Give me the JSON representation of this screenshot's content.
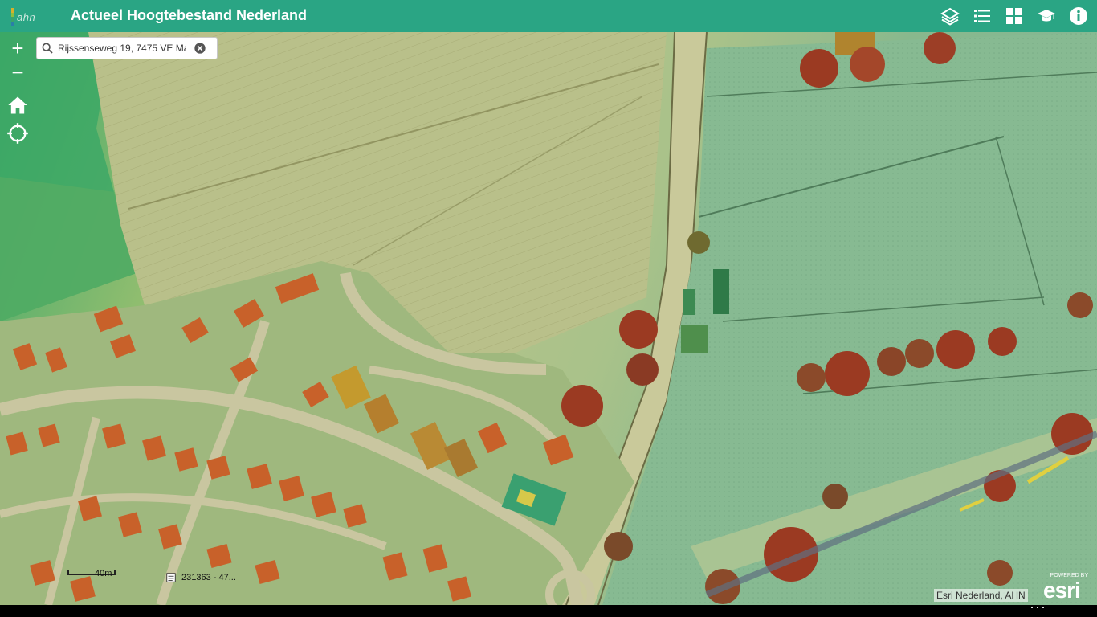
{
  "header": {
    "logo_text": "ahn",
    "title": "Actueel Hoogtebestand Nederland",
    "icons": [
      "layers-icon",
      "legend-icon",
      "basemap-gallery-icon",
      "education-icon",
      "info-icon"
    ]
  },
  "search": {
    "value": "Rijssenseweg 19, 7475 VE Ma"
  },
  "map_controls": {
    "zoom_in": "+",
    "zoom_out": "−"
  },
  "scalebar": {
    "label": "40m"
  },
  "coordinates": {
    "value": "231363 - 47..."
  },
  "attribution": {
    "text": "Esri Nederland, AHN"
  },
  "esri": {
    "powered_by": "POWERED BY",
    "brand": "esri"
  },
  "colors": {
    "header": "#2aa584",
    "accent": "#ffffff"
  }
}
